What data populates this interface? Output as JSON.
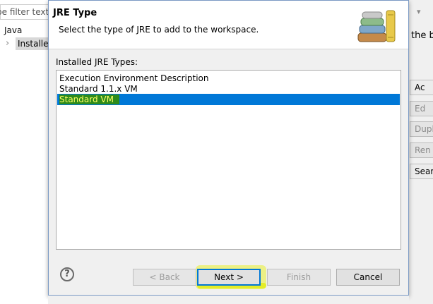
{
  "background": {
    "filter_placeholder": "pe filter text",
    "tree_java": "Java",
    "tree_installed": "Installed",
    "right_text": "the bu",
    "buttons": [
      "Ac",
      "Ed",
      "Dupl",
      "Ren",
      "Sear"
    ]
  },
  "dialog": {
    "title": "JRE Type",
    "subtitle": "Select the type of JRE to add to the workspace.",
    "banner_icon": "books-icon",
    "types_label": "Installed JRE Types:",
    "types": [
      "Execution Environment Description",
      "Standard 1.1.x VM",
      "Standard VM"
    ],
    "selected_type": "Standard VM",
    "buttons": {
      "back": "< Back",
      "next": "Next >",
      "finish": "Finish",
      "cancel": "Cancel"
    },
    "help_icon": "help-icon"
  },
  "colors": {
    "selection": "#0078d7",
    "annotation_highlight": "#e6f000"
  }
}
